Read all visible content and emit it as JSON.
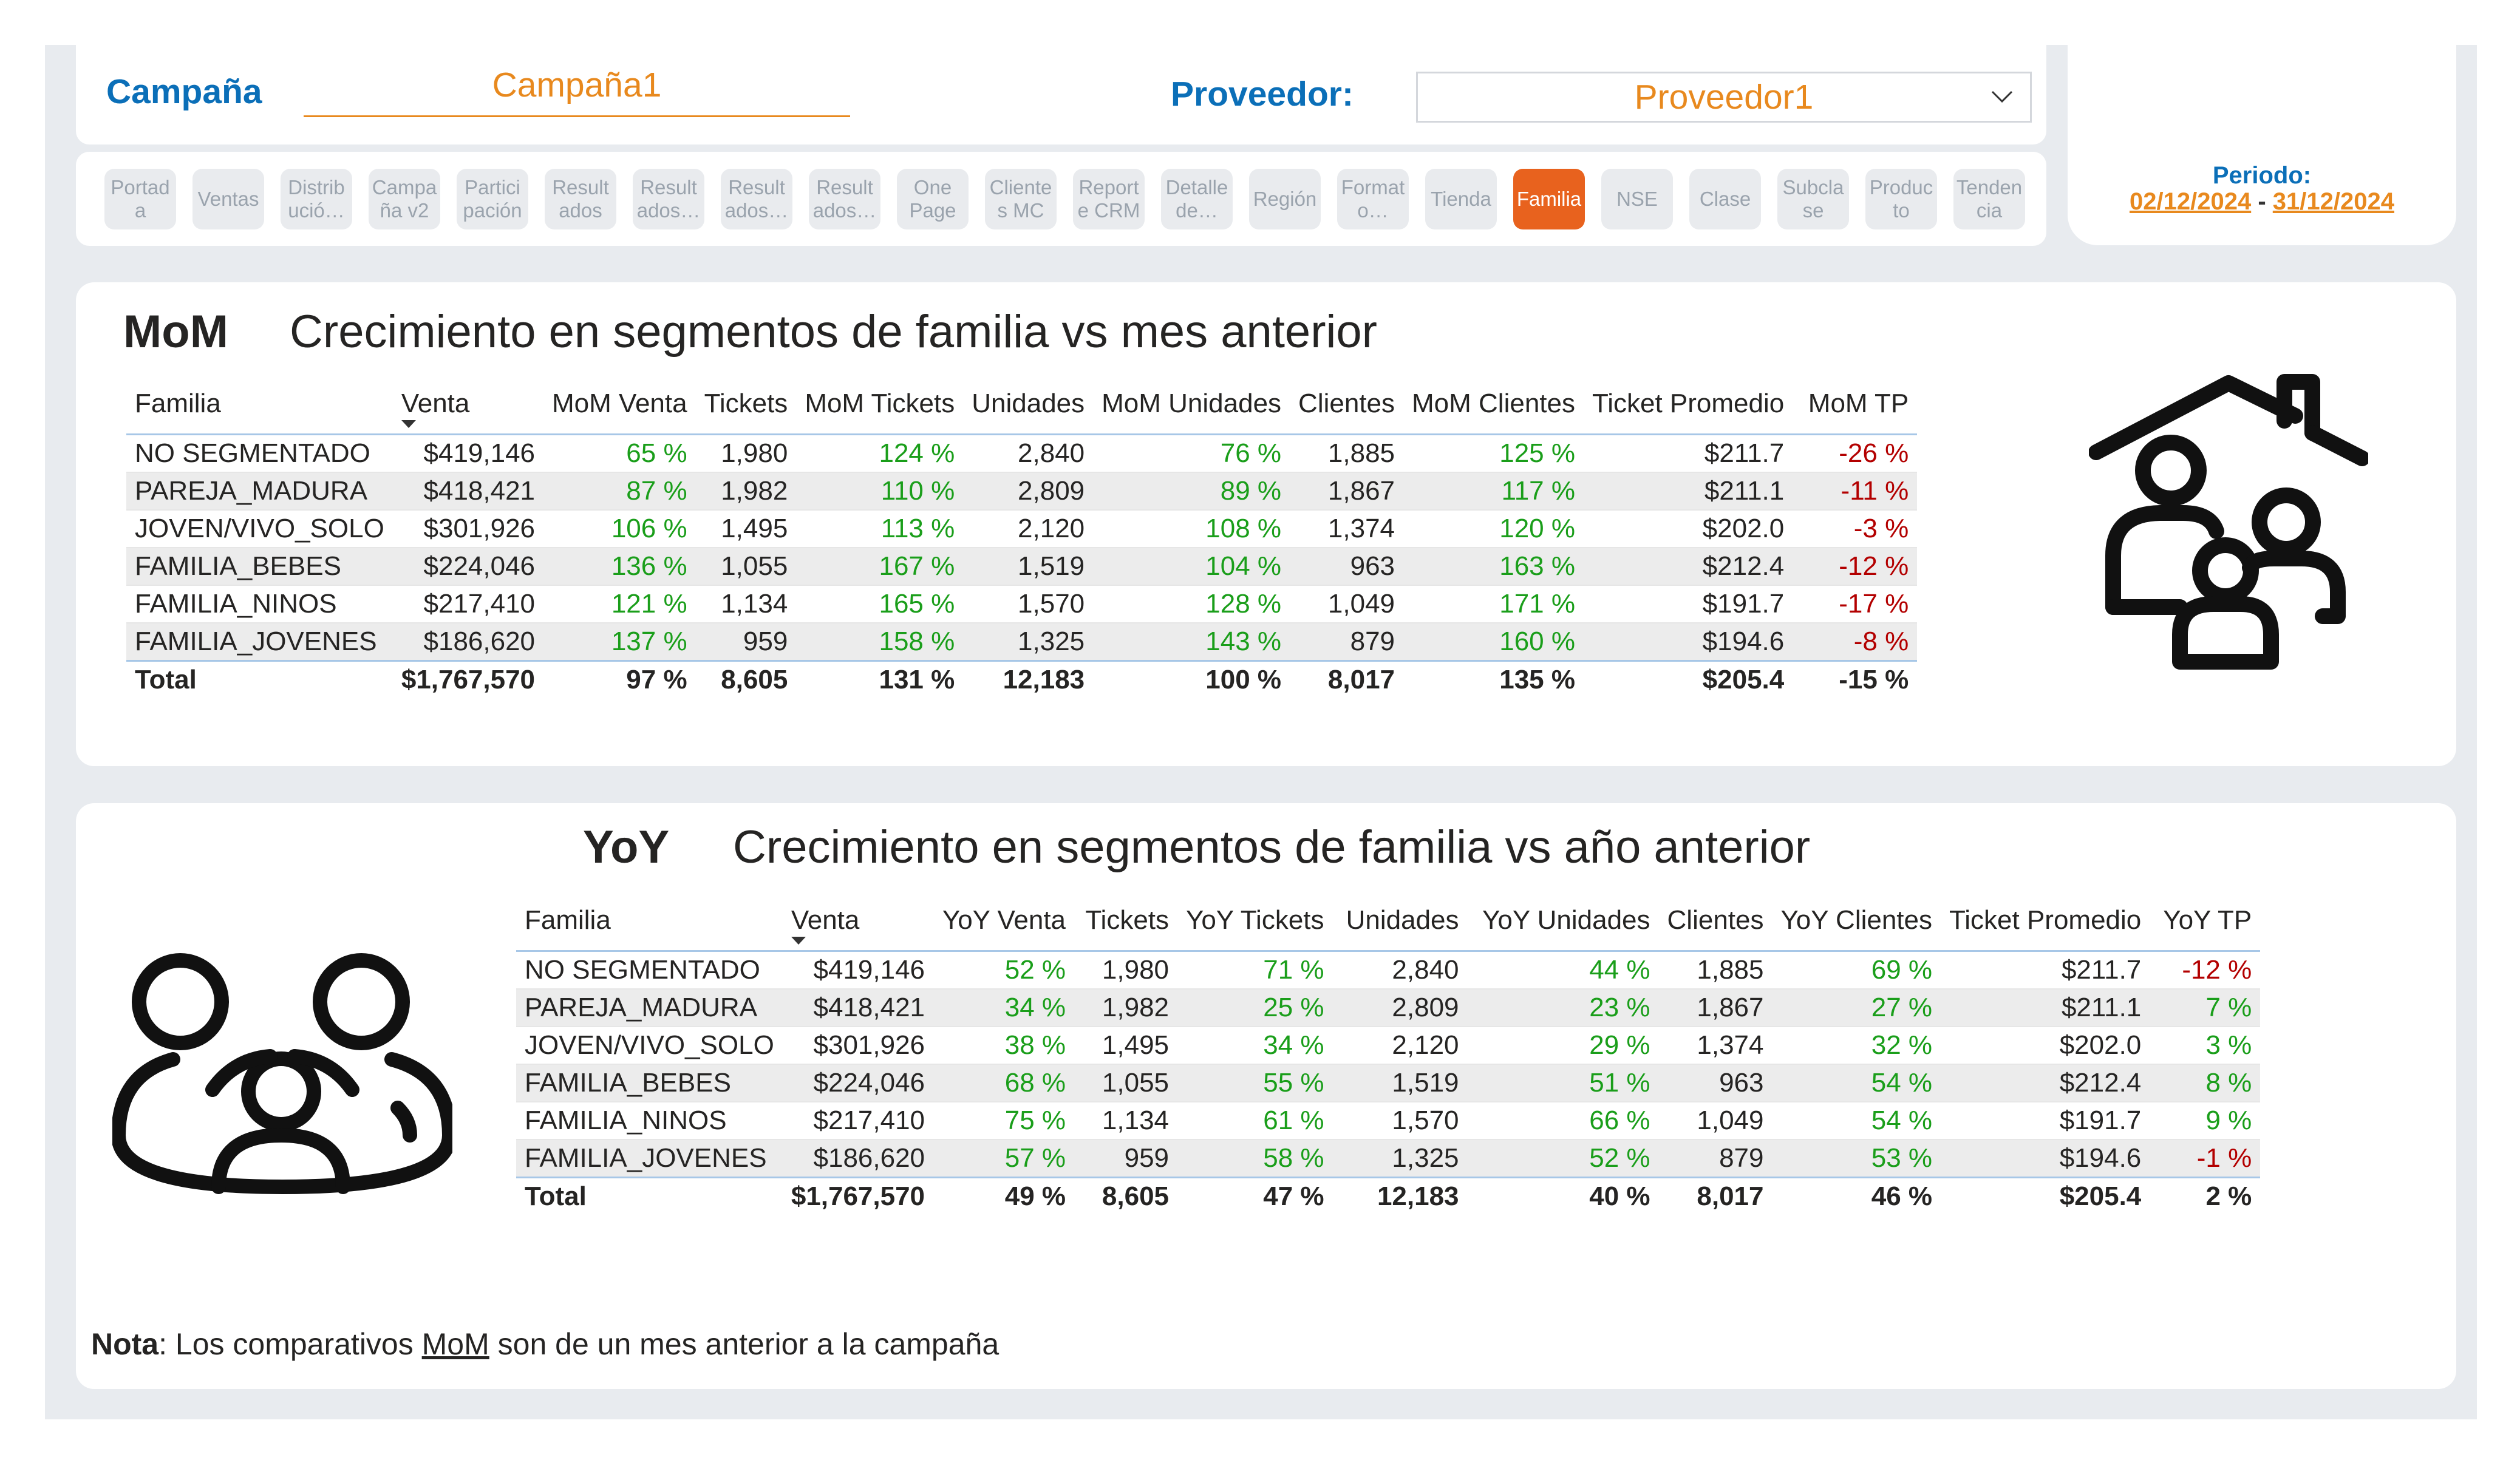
{
  "filters": {
    "campaign_label": "Campaña",
    "campaign_value": "Campaña1",
    "provider_label": "Proveedor:",
    "provider_value": "Proveedor1"
  },
  "tabs": [
    {
      "label": "Portad\na",
      "active": false
    },
    {
      "label": "Ventas",
      "active": false
    },
    {
      "label": "Distrib\nució…",
      "active": false
    },
    {
      "label": "Campa\nña v2",
      "active": false
    },
    {
      "label": "Partici\npación",
      "active": false
    },
    {
      "label": "Result\nados",
      "active": false
    },
    {
      "label": "Result\nados…",
      "active": false
    },
    {
      "label": "Result\nados…",
      "active": false
    },
    {
      "label": "Result\nados…",
      "active": false
    },
    {
      "label": "One\nPage",
      "active": false
    },
    {
      "label": "Cliente\ns MC",
      "active": false
    },
    {
      "label": "Report\ne CRM",
      "active": false
    },
    {
      "label": "Detalle\nde…",
      "active": false
    },
    {
      "label": "Región",
      "active": false
    },
    {
      "label": "Format\no…",
      "active": false
    },
    {
      "label": "Tienda",
      "active": false
    },
    {
      "label": "Familia",
      "active": true
    },
    {
      "label": "NSE",
      "active": false
    },
    {
      "label": "Clase",
      "active": false
    },
    {
      "label": "Subcla\nse",
      "active": false
    },
    {
      "label": "Produc\nto",
      "active": false
    },
    {
      "label": "Tenden\ncia",
      "active": false
    }
  ],
  "period": {
    "label": "Periodo:",
    "start": "02/12/2024",
    "separator": "-",
    "end": "31/12/2024"
  },
  "mom": {
    "label": "MoM",
    "title": "Crecimiento en segmentos de familia vs mes anterior",
    "icon": "family-house-icon",
    "columns": [
      "Familia",
      "Venta",
      "MoM Venta",
      "Tickets",
      "MoM Tickets",
      "Unidades",
      "MoM Unidades",
      "Clientes",
      "MoM Clientes",
      "Ticket Promedio",
      "MoM TP"
    ],
    "rows": [
      [
        "NO SEGMENTADO",
        "$419,146",
        "65 %",
        "1,980",
        "124 %",
        "2,840",
        "76 %",
        "1,885",
        "125 %",
        "$211.7",
        "-26 %"
      ],
      [
        "PAREJA_MADURA",
        "$418,421",
        "87 %",
        "1,982",
        "110 %",
        "2,809",
        "89 %",
        "1,867",
        "117 %",
        "$211.1",
        "-11 %"
      ],
      [
        "JOVEN/VIVO_SOLO",
        "$301,926",
        "106 %",
        "1,495",
        "113 %",
        "2,120",
        "108 %",
        "1,374",
        "120 %",
        "$202.0",
        "-3 %"
      ],
      [
        "FAMILIA_BEBES",
        "$224,046",
        "136 %",
        "1,055",
        "167 %",
        "1,519",
        "104 %",
        "963",
        "163 %",
        "$212.4",
        "-12 %"
      ],
      [
        "FAMILIA_NINOS",
        "$217,410",
        "121 %",
        "1,134",
        "165 %",
        "1,570",
        "128 %",
        "1,049",
        "171 %",
        "$191.7",
        "-17 %"
      ],
      [
        "FAMILIA_JOVENES",
        "$186,620",
        "137 %",
        "959",
        "158 %",
        "1,325",
        "143 %",
        "879",
        "160 %",
        "$194.6",
        "-8 %"
      ]
    ],
    "total": [
      "Total",
      "$1,767,570",
      "97 %",
      "8,605",
      "131 %",
      "12,183",
      "100 %",
      "8,017",
      "135 %",
      "$205.4",
      "-15 %"
    ]
  },
  "yoy": {
    "label": "YoY",
    "title": "Crecimiento en segmentos de familia vs año anterior",
    "icon": "group-people-icon",
    "columns": [
      "Familia",
      "Venta",
      "YoY Venta",
      "Tickets",
      "YoY Tickets",
      "Unidades",
      "YoY Unidades",
      "Clientes",
      "YoY Clientes",
      "Ticket Promedio",
      "YoY TP"
    ],
    "rows": [
      [
        "NO SEGMENTADO",
        "$419,146",
        "52 %",
        "1,980",
        "71 %",
        "2,840",
        "44 %",
        "1,885",
        "69 %",
        "$211.7",
        "-12 %"
      ],
      [
        "PAREJA_MADURA",
        "$418,421",
        "34 %",
        "1,982",
        "25 %",
        "2,809",
        "23 %",
        "1,867",
        "27 %",
        "$211.1",
        "7 %"
      ],
      [
        "JOVEN/VIVO_SOLO",
        "$301,926",
        "38 %",
        "1,495",
        "34 %",
        "2,120",
        "29 %",
        "1,374",
        "32 %",
        "$202.0",
        "3 %"
      ],
      [
        "FAMILIA_BEBES",
        "$224,046",
        "68 %",
        "1,055",
        "55 %",
        "1,519",
        "51 %",
        "963",
        "54 %",
        "$212.4",
        "8 %"
      ],
      [
        "FAMILIA_NINOS",
        "$217,410",
        "75 %",
        "1,134",
        "61 %",
        "1,570",
        "66 %",
        "1,049",
        "54 %",
        "$191.7",
        "9 %"
      ],
      [
        "FAMILIA_JOVENES",
        "$186,620",
        "57 %",
        "959",
        "58 %",
        "1,325",
        "52 %",
        "879",
        "53 %",
        "$194.6",
        "-1 %"
      ]
    ],
    "total": [
      "Total",
      "$1,767,570",
      "49 %",
      "8,605",
      "47 %",
      "12,183",
      "40 %",
      "8,017",
      "46 %",
      "$205.4",
      "2 %"
    ]
  },
  "note": {
    "bold": "Nota",
    "pre": ": Los comparativos ",
    "underlined": "MoM",
    "post": " son de un mes anterior a la campaña"
  },
  "colors": {
    "accent_orange": "#e8621e",
    "value_orange": "#e8891e",
    "title_blue": "#0b6fb8",
    "positive": "#1a9e1a",
    "negative": "#b30000"
  }
}
